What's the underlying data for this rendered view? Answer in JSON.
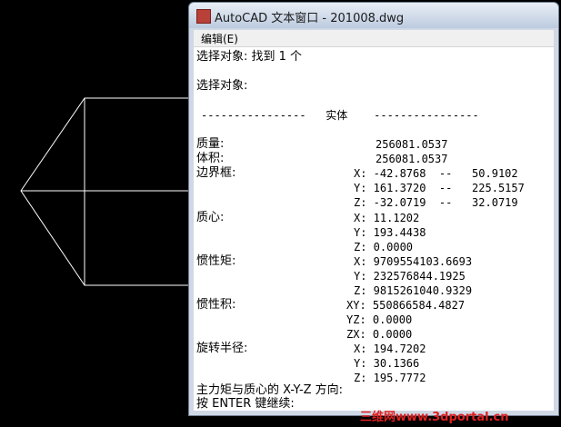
{
  "window": {
    "title": "AutoCAD 文本窗口 - 201008.dwg",
    "menu_edit": "编辑(E)"
  },
  "text": {
    "select_found": "选择对象: 找到 1 个",
    "select": "选择对象:",
    "header": "----------------   实体    ----------------",
    "mass_label": "质量:",
    "mass_value": "256081.0537",
    "volume_label": "体积:",
    "volume_value": "256081.0537",
    "bbox_label": "边界框:",
    "bbox": [
      "X: -42.8768  --   50.9102",
      "Y: 161.3720  --   225.5157",
      "Z: -32.0719  --   32.0719"
    ],
    "centroid_label": "质心:",
    "centroid": [
      "X: 11.1202",
      "Y: 193.4438",
      "Z: 0.0000"
    ],
    "moments_label": "惯性矩:",
    "moments": [
      "X: 9709554103.6693",
      "Y: 232576844.1925",
      "Z: 9815261040.9329"
    ],
    "products_label": "惯性积:",
    "products": [
      "XY: 550866584.4827",
      "YZ: 0.0000",
      "ZX: 0.0000"
    ],
    "gyration_label": "旋转半径:",
    "gyration": [
      "X: 194.7202",
      "Y: 30.1366",
      "Z: 195.7772"
    ],
    "principal": "主力矩与质心的 X-Y-Z 方向:",
    "press_enter": "按 ENTER 键继续:"
  },
  "watermark": "三维网www.3dportal.cn"
}
